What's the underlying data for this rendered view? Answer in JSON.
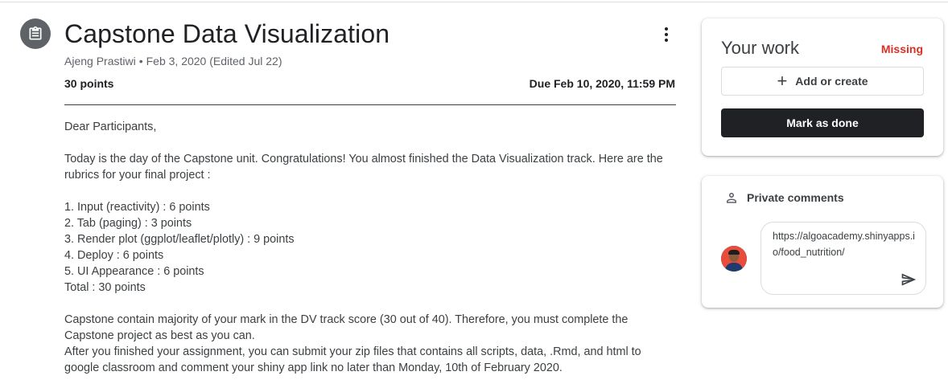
{
  "assignment": {
    "title": "Capstone Data Visualization",
    "author": "Ajeng Prastiwi",
    "date": "Feb 3, 2020 (Edited Jul 22)",
    "points": "30 points",
    "due": "Due Feb 10, 2020, 11:59 PM",
    "icon": "assignment-icon",
    "body": {
      "greeting": "Dear Participants,",
      "intro": "Today is the day of the Capstone unit. Congratulations! You almost finished the Data Visualization track. Here are the rubrics for your final project :",
      "rubric": [
        "1. Input (reactivity) : 6 points",
        "2. Tab (paging) : 3 points",
        "3. Render plot (ggplot/leaflet/plotly) : 9 points",
        "4. Deploy : 6 points",
        "5. UI Appearance : 6 points",
        "Total : 30 points"
      ],
      "paragraph1": "Capstone contain majority of your mark in the DV track score (30 out of 40). Therefore, you must complete the Capstone project as best as you can.",
      "paragraph2": "After you finished your assignment, you can submit your zip files that contains all scripts, data, .Rmd, and html to google classroom and comment your shiny app link no later than Monday, 10th of February 2020."
    }
  },
  "your_work": {
    "title": "Your work",
    "status": "Missing",
    "status_color": "#d93025",
    "add_label": "Add or create",
    "done_label": "Mark as done"
  },
  "private_comments": {
    "title": "Private comments",
    "draft": "https://algoacademy.shinyapps.io/food_nutrition/"
  }
}
